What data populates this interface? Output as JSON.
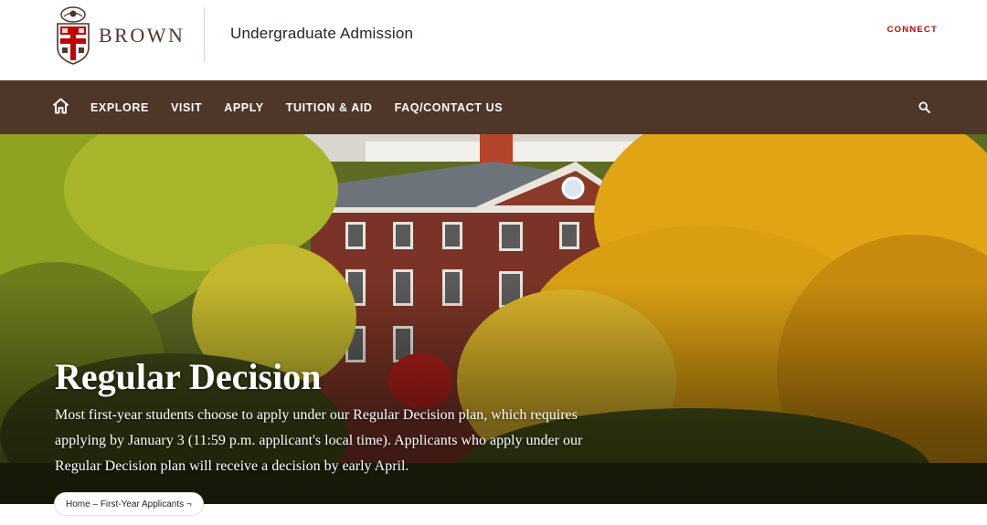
{
  "header": {
    "wordmark": "BROWN",
    "site_title": "Undergraduate Admission",
    "connect_label": "CONNECT"
  },
  "nav": {
    "items": [
      {
        "label": "EXPLORE"
      },
      {
        "label": "VISIT"
      },
      {
        "label": "APPLY"
      },
      {
        "label": "TUITION & AID"
      },
      {
        "label": "FAQ/CONTACT US"
      }
    ],
    "home_icon": "home-icon",
    "search_icon": "search-icon"
  },
  "hero": {
    "title": "Regular Decision",
    "body": "Most first-year students choose to apply under our Regular Decision plan, which requires applying by January 3 (11:59 p.m. applicant's local time). Applicants who apply under our Regular Decision plan will receive a decision by early April."
  },
  "breadcrumb": {
    "home": "Home",
    "separator": " – ",
    "current": "First-Year Applicants",
    "toggle": " ¬"
  },
  "colors": {
    "brand_brown": "#4e3629",
    "accent_red": "#c00404",
    "white": "#ffffff"
  }
}
